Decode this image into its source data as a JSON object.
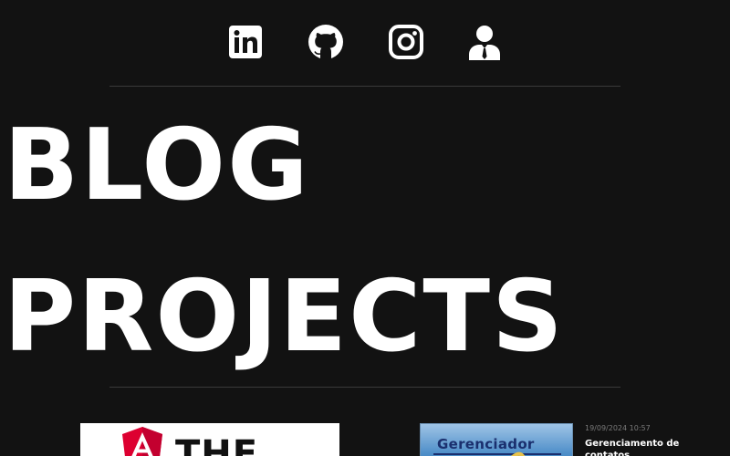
{
  "social": {
    "items": [
      {
        "name": "LinkedIn",
        "icon": "linkedin-icon"
      },
      {
        "name": "GitHub",
        "icon": "github-icon"
      },
      {
        "name": "Instagram",
        "icon": "instagram-icon"
      },
      {
        "name": "About",
        "icon": "user-icon"
      }
    ]
  },
  "hero": {
    "line1": "BLOG",
    "line2": "PROJECTS"
  },
  "posts": [
    {
      "thumbnail_text": "THE",
      "thumbnail_icon": "angular-logo-icon"
    },
    {
      "thumbnail_text": "Gerenciador",
      "date": "19/09/2024 10:57",
      "title": "Gerenciamento de contatos"
    }
  ],
  "colors": {
    "background": "#121212",
    "text": "#ffffff",
    "muted": "#7a7a7a",
    "divider": "#3a3a3a",
    "angular_red": "#dd0031"
  }
}
